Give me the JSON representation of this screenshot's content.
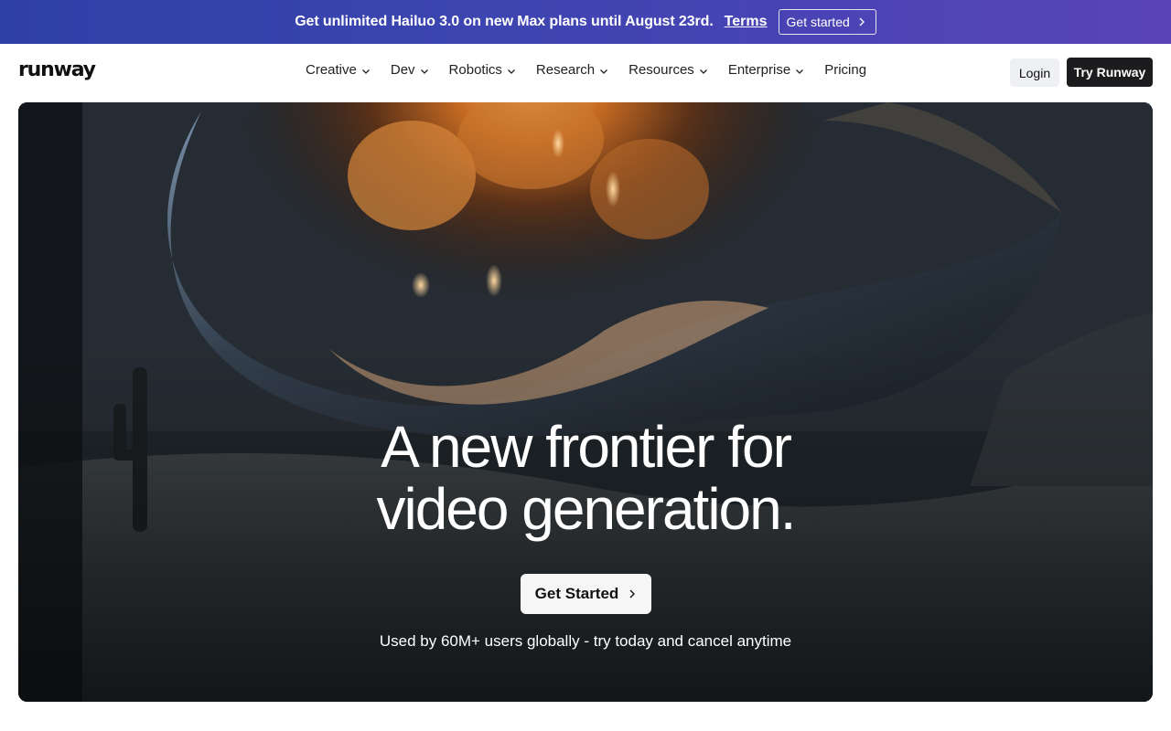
{
  "banner": {
    "message": "Get unlimited Hailuo 3.0 on new Max plans until August 23rd.",
    "terms_label": "Terms",
    "cta_label": "Get started"
  },
  "nav": {
    "logo": "runway",
    "items": [
      {
        "label": "Creative",
        "dropdown": true
      },
      {
        "label": "Dev",
        "dropdown": true
      },
      {
        "label": "Robotics",
        "dropdown": true
      },
      {
        "label": "Research",
        "dropdown": true
      },
      {
        "label": "Resources",
        "dropdown": true
      },
      {
        "label": "Enterprise",
        "dropdown": true
      },
      {
        "label": "Pricing",
        "dropdown": false
      }
    ],
    "login_label": "Login",
    "try_label": "Try Runway"
  },
  "hero": {
    "headline_line1": "A new frontier for",
    "headline_line2": "video generation.",
    "cta_label": "Get Started",
    "subtext": "Used by 60M+ users globally - try today and cancel anytime"
  },
  "colors": {
    "banner_start": "#2f3fa8",
    "banner_end": "#5a45b8",
    "primary_button": "#1c1c1e",
    "login_bg": "#eef0f3"
  },
  "icons": {
    "dropdown": "chevron-down-icon",
    "cta_arrow": "chevron-right-icon"
  }
}
